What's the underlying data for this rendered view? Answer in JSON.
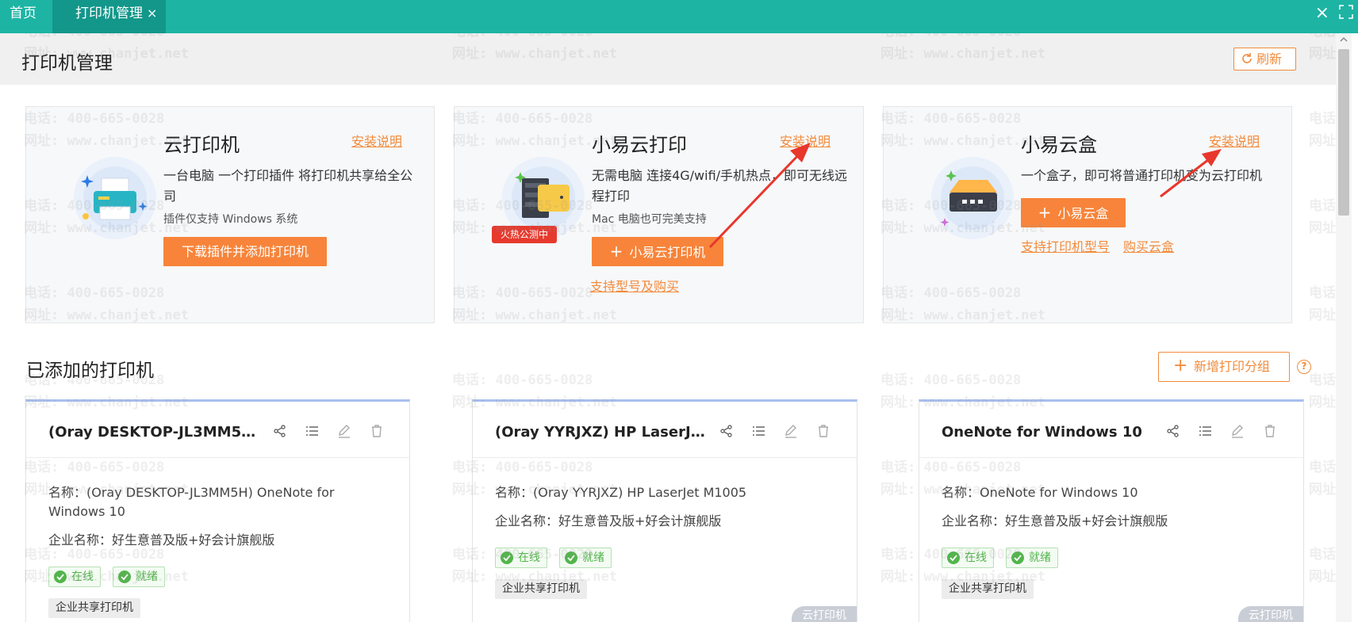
{
  "tabs": {
    "home": "首页",
    "active": "打印机管理",
    "close": "×"
  },
  "window": {
    "close": "×"
  },
  "header": {
    "title": "打印机管理",
    "refresh": "刷新"
  },
  "watermark": {
    "phone": "电话: 400-665-0028",
    "site": "网址: www.chanjet.net"
  },
  "features": [
    {
      "title": "云打印机",
      "link": "安装说明",
      "desc": "一台电脑 一个打印插件 将打印机共享给全公司",
      "note": "插件仅支持 Windows 系统",
      "button": "下载插件并添加打印机"
    },
    {
      "title": "小易云打印",
      "link": "安装说明",
      "desc": "无需电脑 连接4G/wifi/手机热点，即可无线远程打印",
      "note": "Mac 电脑也可完美支持",
      "badge": "火热公测中",
      "button": "小易云打印机",
      "sublink": "支持型号及购买"
    },
    {
      "title": "小易云盒",
      "link": "安装说明",
      "desc": "一个盒子，即可将普通打印机变为云打印机",
      "button": "小易云盒",
      "sublink1": "支持打印机型号",
      "sublink2": "购买云盒"
    }
  ],
  "section": {
    "title": "已添加的打印机",
    "add_group": "新增打印分组",
    "help": "?"
  },
  "printers": [
    {
      "title": "(Oray DESKTOP-JL3MM5H) ...",
      "name": "名称：(Oray DESKTOP-JL3MM5H) OneNote for Windows 10",
      "company": "企业名称：好生意普及版+好会计旗舰版",
      "status_online": "在线",
      "status_ready": "就绪",
      "tag": "企业共享打印机"
    },
    {
      "title": "(Oray YYRJXZ) HP LaserJet ...",
      "name": "名称：(Oray YYRJXZ) HP LaserJet M1005",
      "company": "企业名称：好生意普及版+好会计旗舰版",
      "status_online": "在线",
      "status_ready": "就绪",
      "tag": "企业共享打印机",
      "corner": "云打印机"
    },
    {
      "title": "OneNote for Windows 10",
      "name": "名称：OneNote for Windows 10",
      "company": "企业名称：好生意普及版+好会计旗舰版",
      "status_online": "在线",
      "status_ready": "就绪",
      "tag": "企业共享打印机",
      "corner": "云打印机"
    }
  ],
  "colors": {
    "topbar": "#1db4a4",
    "accent": "#f28b3c",
    "button": "#f7843a",
    "online": "#52b54b"
  },
  "icons": [
    "maximize-icon",
    "refresh-icon",
    "printer-icon",
    "cloud-printer-icon",
    "cloud-box-icon",
    "share-icon",
    "list-icon",
    "edit-icon",
    "delete-icon",
    "check-icon"
  ]
}
